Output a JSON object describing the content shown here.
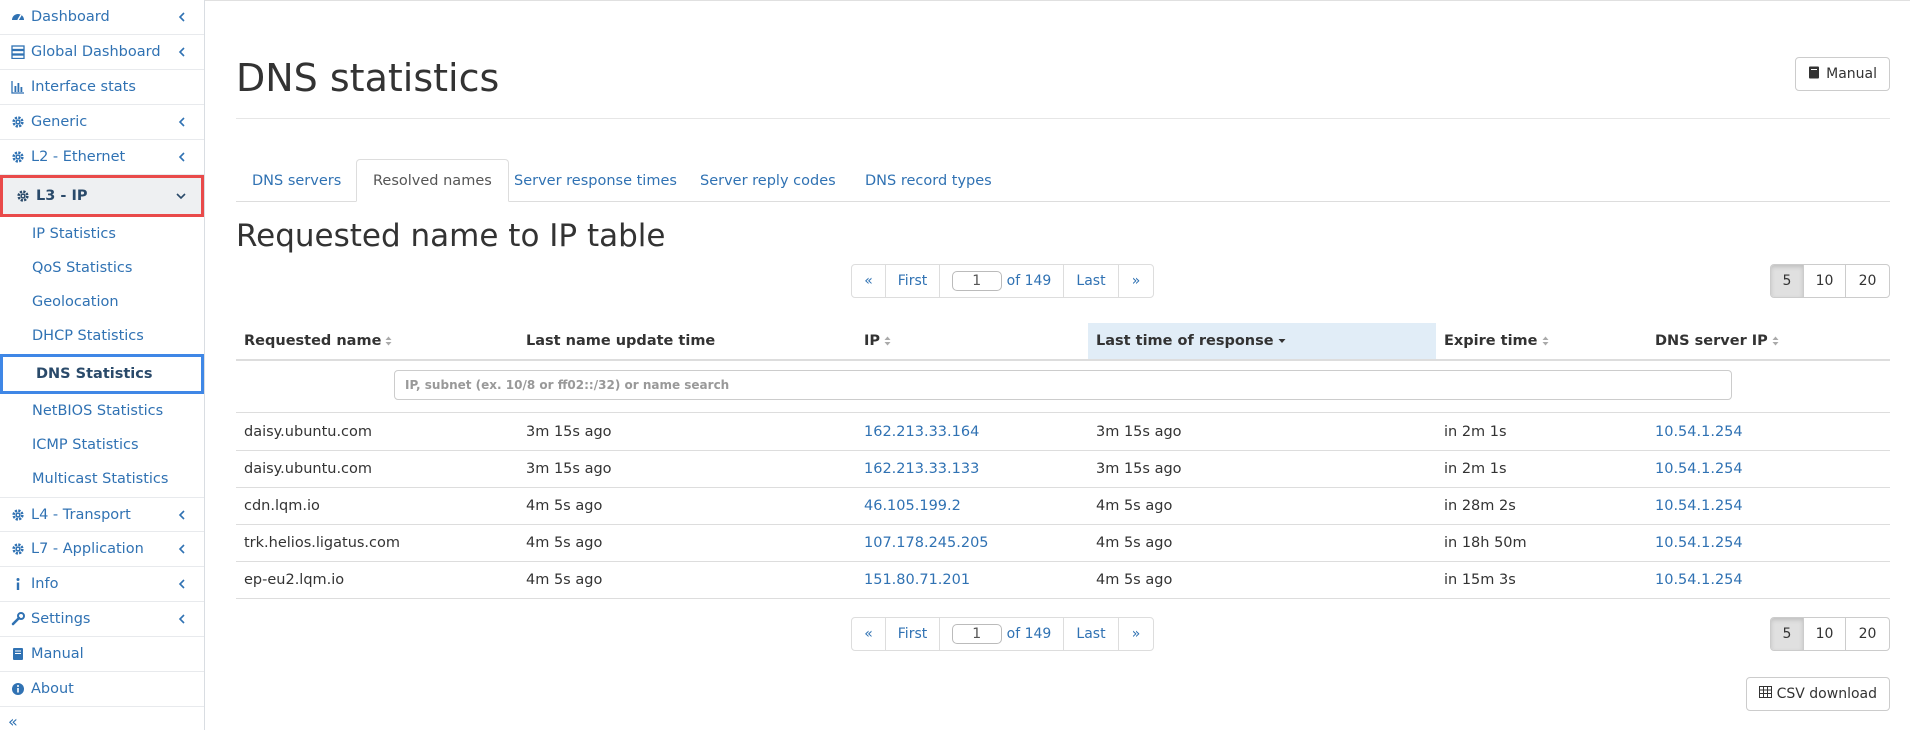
{
  "sidebar": {
    "items": [
      {
        "label": "Dashboard",
        "icon": "dashboard-icon"
      },
      {
        "label": "Global Dashboard",
        "icon": "server-icon"
      },
      {
        "label": "Interface stats",
        "icon": "bar-chart-icon"
      },
      {
        "label": "Generic",
        "icon": "gear-icon"
      },
      {
        "label": "L2 - Ethernet",
        "icon": "gear-icon"
      },
      {
        "label": "L3 - IP",
        "icon": "gear-icon"
      },
      {
        "label": "L4 - Transport",
        "icon": "gear-icon"
      },
      {
        "label": "L7 - Application",
        "icon": "gear-icon"
      },
      {
        "label": "Info",
        "icon": "info-icon"
      },
      {
        "label": "Settings",
        "icon": "wrench-icon"
      },
      {
        "label": "Manual",
        "icon": "book-icon"
      },
      {
        "label": "About",
        "icon": "info-circle-icon"
      }
    ],
    "l3_sub": [
      {
        "label": "IP Statistics"
      },
      {
        "label": "QoS Statistics"
      },
      {
        "label": "Geolocation"
      },
      {
        "label": "DHCP Statistics"
      },
      {
        "label": "DNS Statistics"
      },
      {
        "label": "NetBIOS Statistics"
      },
      {
        "label": "ICMP Statistics"
      },
      {
        "label": "Multicast Statistics"
      }
    ],
    "collapse": "«"
  },
  "page": {
    "title": "DNS statistics",
    "manual_label": "Manual"
  },
  "tabs": [
    {
      "label": "DNS servers"
    },
    {
      "label": "Resolved names"
    },
    {
      "label": "Server response times"
    },
    {
      "label": "Server reply codes"
    },
    {
      "label": "DNS record types"
    }
  ],
  "section_title": "Requested name to IP table",
  "pager": {
    "prev": "«",
    "first": "First",
    "current": "1",
    "of_text": "of 149",
    "last": "Last",
    "next": "»"
  },
  "per_page": [
    "5",
    "10",
    "20"
  ],
  "table": {
    "headers": [
      "Requested name",
      "Last name update time",
      "IP",
      "Last time of response",
      "Expire time",
      "DNS server IP"
    ],
    "filter_placeholder": "IP, subnet (ex. 10/8 or ff02::/32) or name search",
    "rows": [
      [
        "daisy.ubuntu.com",
        "3m 15s ago",
        "162.213.33.164",
        "3m 15s ago",
        "in 2m 1s",
        "10.54.1.254"
      ],
      [
        "daisy.ubuntu.com",
        "3m 15s ago",
        "162.213.33.133",
        "3m 15s ago",
        "in 2m 1s",
        "10.54.1.254"
      ],
      [
        "cdn.lqm.io",
        "4m 5s ago",
        "46.105.199.2",
        "4m 5s ago",
        "in 28m 2s",
        "10.54.1.254"
      ],
      [
        "trk.helios.ligatus.com",
        "4m 5s ago",
        "107.178.245.205",
        "4m 5s ago",
        "in 18h 50m",
        "10.54.1.254"
      ],
      [
        "ep-eu2.lqm.io",
        "4m 5s ago",
        "151.80.71.201",
        "4m 5s ago",
        "in 15m 3s",
        "10.54.1.254"
      ]
    ]
  },
  "csv_label": "CSV download",
  "colors": {
    "link": "#3072b3",
    "active_group_border": "#e94a4a",
    "active_sub_border": "#3f87e6",
    "sorted_header": "#e1edf7"
  }
}
